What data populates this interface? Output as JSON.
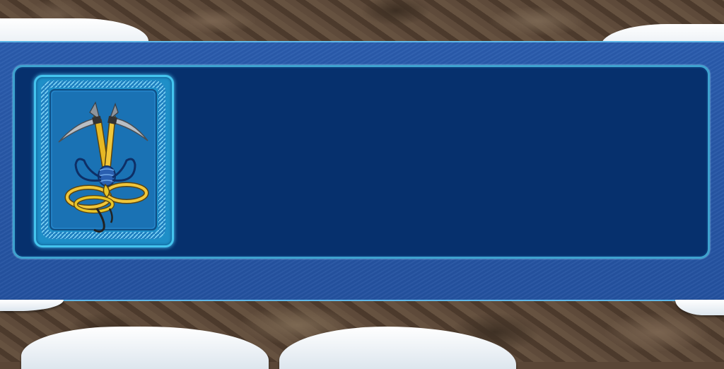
{
  "scene": {
    "background": "rock-wall",
    "panel_color": "#2a5cad",
    "inner_panel_color": "#06306d",
    "accent_color": "#44c4ee"
  },
  "badge": {
    "icon": "ice-axes-and-rope-icon",
    "frame_color": "#1e8fc8",
    "rope_color": "#e8c62a"
  }
}
